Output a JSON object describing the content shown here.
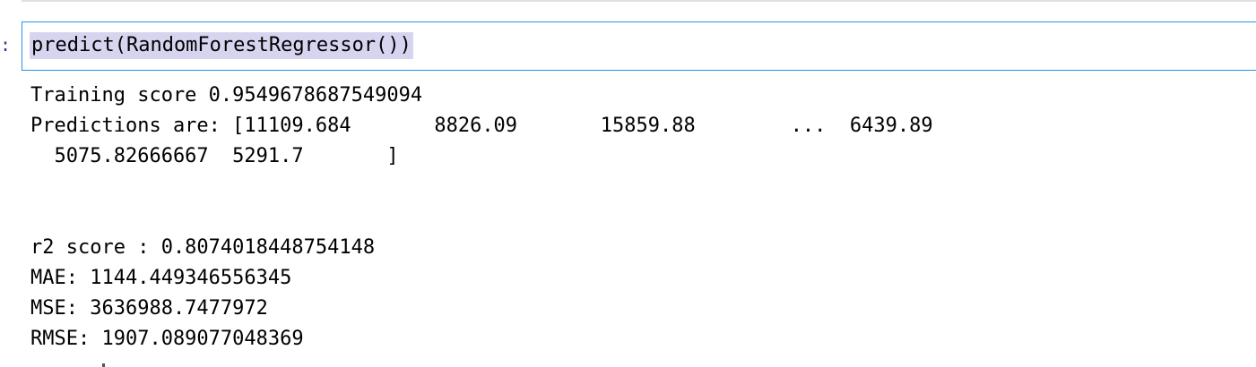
{
  "cell": {
    "prompt": ":",
    "code": "predict(RandomForestRegressor())"
  },
  "output": {
    "lines": [
      "Training score 0.9549678687549094",
      "Predictions are: [11109.684       8826.09       15859.88        ...  6439.89",
      "  5075.82666667  5291.7       ]",
      "",
      "",
      "r2 score : 0.8074018448754148",
      "MAE: 1144.449346556345",
      "MSE: 3636988.7477972",
      "RMSE: 1907.089077048369"
    ]
  }
}
